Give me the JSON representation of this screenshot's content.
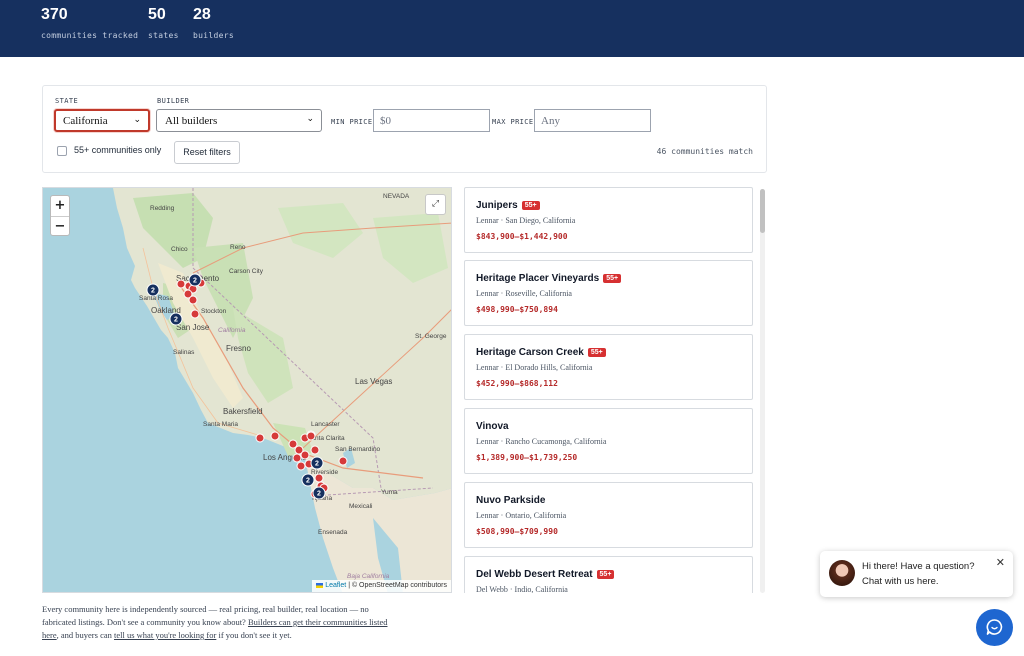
{
  "header": {
    "stats": [
      {
        "value": "370",
        "label": "communities tracked"
      },
      {
        "value": "50",
        "label": "states"
      },
      {
        "value": "28",
        "label": "builders"
      }
    ]
  },
  "filters": {
    "state_label": "STATE",
    "state_value": "California",
    "builder_label": "BUILDER",
    "builder_value": "All builders",
    "min_price_label": "MIN PRICE",
    "min_price_placeholder": "$0",
    "max_price_label": "MAX PRICE",
    "max_price_placeholder": "Any",
    "senior_label": "55+ communities only",
    "senior_checked": false,
    "reset_label": "Reset filters",
    "match_text": "46 communities match"
  },
  "map": {
    "zoom_in": "+",
    "zoom_out": "−",
    "fullscreen": "⤢",
    "places": [
      {
        "name": "Redding"
      },
      {
        "name": "Chico"
      },
      {
        "name": "Reno"
      },
      {
        "name": "Carson City"
      },
      {
        "name": "Sacramento"
      },
      {
        "name": "Santa Rosa"
      },
      {
        "name": "Oakland"
      },
      {
        "name": "San Jose"
      },
      {
        "name": "Stockton"
      },
      {
        "name": "Salinas"
      },
      {
        "name": "Fresno"
      },
      {
        "name": "California"
      },
      {
        "name": "St. George"
      },
      {
        "name": "Las Vegas"
      },
      {
        "name": "Bakersfield"
      },
      {
        "name": "Santa Maria"
      },
      {
        "name": "Lancaster"
      },
      {
        "name": "Santa Clarita"
      },
      {
        "name": "San Bernardino"
      },
      {
        "name": "Los Angeles"
      },
      {
        "name": "Riverside"
      },
      {
        "name": "Yuma"
      },
      {
        "name": "Tijuana"
      },
      {
        "name": "Mexicali"
      },
      {
        "name": "Ensenada"
      },
      {
        "name": "Baja California"
      },
      {
        "name": "NEVADA"
      }
    ],
    "clusters": [
      {
        "count": "2"
      },
      {
        "count": "2"
      },
      {
        "count": "2"
      },
      {
        "count": "2"
      },
      {
        "count": "2"
      },
      {
        "count": "2"
      }
    ],
    "attribution_leaflet": "Leaflet",
    "attribution_osm": "| © OpenStreetMap contributors"
  },
  "listings": [
    {
      "name": "Junipers",
      "badge": "55+",
      "sub": "Lennar · San Diego, California",
      "price": "$843,900–$1,442,900"
    },
    {
      "name": "Heritage Placer Vineyards",
      "badge": "55+",
      "sub": "Lennar · Roseville, California",
      "price": "$498,990–$750,894"
    },
    {
      "name": "Heritage Carson Creek",
      "badge": "55+",
      "sub": "Lennar · El Dorado Hills, California",
      "price": "$452,990–$868,112"
    },
    {
      "name": "Vinova",
      "badge": "",
      "sub": "Lennar · Rancho Cucamonga, California",
      "price": "$1,389,900–$1,739,250"
    },
    {
      "name": "Nuvo Parkside",
      "badge": "",
      "sub": "Lennar · Ontario, California",
      "price": "$508,990–$709,990"
    },
    {
      "name": "Del Webb Desert Retreat",
      "badge": "55+",
      "sub": "Del Webb · Indio, California",
      "price": ""
    }
  ],
  "footer": {
    "text1": "Every community here is independently sourced — real pricing, real builder, real location — no fabricated listings. Don't see a community you know about? ",
    "link1": "Builders can get their communities listed here",
    "text2": ", and buyers can ",
    "link2": "tell us what you're looking for",
    "text3": " if you don't see it yet."
  },
  "chat": {
    "line1": "Hi there! Have a question?",
    "line2": "Chat with us here.",
    "close": "✕"
  }
}
